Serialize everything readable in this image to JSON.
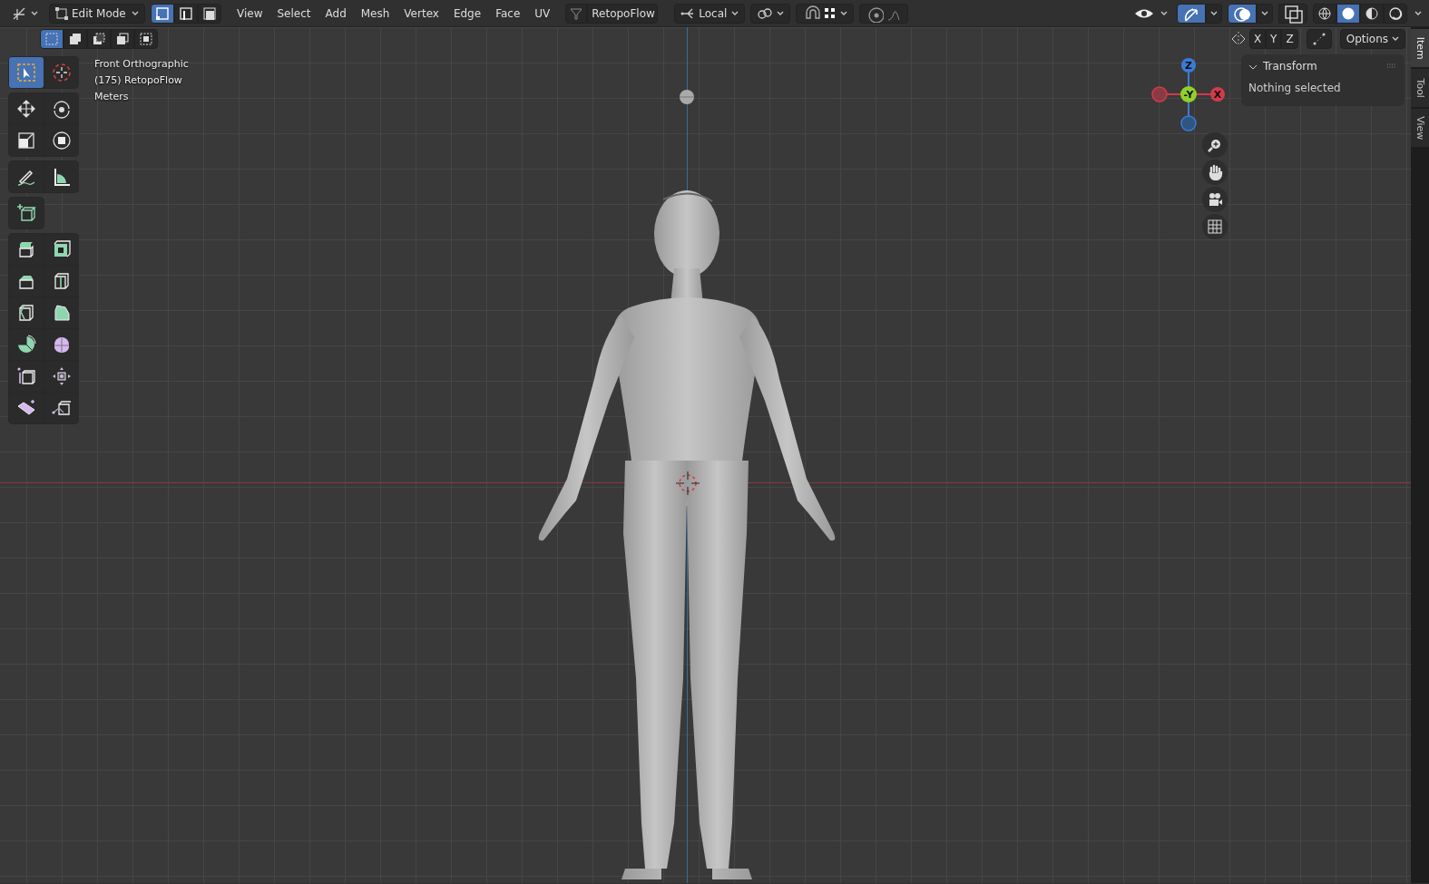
{
  "header": {
    "mode": "Edit Mode",
    "select_modes": [
      {
        "kind": "vertex",
        "selected": true
      },
      {
        "kind": "edge",
        "selected": false
      },
      {
        "kind": "face",
        "selected": false
      }
    ],
    "menus": [
      "View",
      "Select",
      "Add",
      "Mesh",
      "Vertex",
      "Edge",
      "Face",
      "UV"
    ],
    "retopo": "RetopoFlow",
    "orientation": "Local",
    "left_toggles": [
      {
        "kind": "snap",
        "on": false
      },
      {
        "kind": "proportional",
        "on": false
      }
    ],
    "right_toggles": [
      {
        "kind": "visibility",
        "on": false
      },
      {
        "kind": "gizmo",
        "on": true
      },
      {
        "kind": "overlays",
        "on": true
      },
      {
        "kind": "xray",
        "on": false
      }
    ],
    "shading": [
      {
        "kind": "wire",
        "selected": false
      },
      {
        "kind": "solid",
        "selected": true
      },
      {
        "kind": "material",
        "selected": false
      },
      {
        "kind": "rendered",
        "selected": false
      }
    ]
  },
  "tool_header": {
    "box_modes": [
      {
        "kind": "new",
        "selected": true
      },
      {
        "kind": "extend",
        "selected": false
      },
      {
        "kind": "subtract",
        "selected": false
      },
      {
        "kind": "invert",
        "selected": false
      },
      {
        "kind": "intersect",
        "selected": false
      }
    ],
    "axes": [
      "X",
      "Y",
      "Z"
    ],
    "options": "Options"
  },
  "viewport_info": [
    "Front Orthographic",
    "(175) RetopoFlow",
    "Meters"
  ],
  "tool_groups": [
    {
      "tools": [
        {
          "kind": "select_box",
          "selected": true
        },
        {
          "kind": "cursor",
          "selected": false
        }
      ]
    },
    {
      "tools": [
        {
          "kind": "move",
          "selected": false
        },
        {
          "kind": "rotate",
          "selected": false
        },
        {
          "kind": "scale",
          "selected": false
        },
        {
          "kind": "transform",
          "selected": false
        }
      ]
    },
    {
      "tools": [
        {
          "kind": "annotate",
          "selected": false
        },
        {
          "kind": "measure",
          "selected": false
        }
      ]
    },
    {
      "tools": [
        {
          "kind": "add_cube",
          "selected": false
        }
      ]
    },
    {
      "tools": [
        {
          "kind": "extrude",
          "selected": false
        },
        {
          "kind": "inset",
          "selected": false
        },
        {
          "kind": "bevel",
          "selected": false
        },
        {
          "kind": "loop_cut",
          "selected": false
        },
        {
          "kind": "knife",
          "selected": false
        },
        {
          "kind": "poly_build",
          "selected": false
        },
        {
          "kind": "spin",
          "selected": false
        },
        {
          "kind": "smooth",
          "selected": false
        },
        {
          "kind": "edge_slide",
          "selected": false
        },
        {
          "kind": "shrink",
          "selected": false
        },
        {
          "kind": "shear",
          "selected": false
        },
        {
          "kind": "rip",
          "selected": false
        }
      ]
    }
  ],
  "gizmo": {
    "z": "Z",
    "y": "-Y",
    "x": "X"
  },
  "sidebar": {
    "panel": {
      "title": "Transform",
      "expanded": true,
      "message": "Nothing selected"
    },
    "tabs": [
      {
        "label": "Item",
        "selected": true
      },
      {
        "label": "Tool",
        "selected": false
      },
      {
        "label": "View",
        "selected": false
      }
    ]
  }
}
